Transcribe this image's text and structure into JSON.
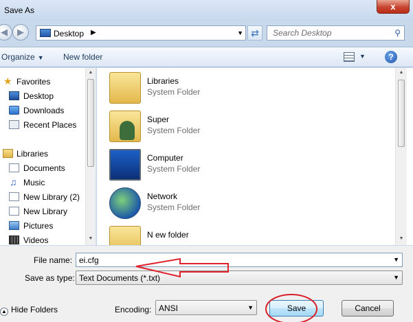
{
  "window": {
    "title": "Save As",
    "close_glyph": "x"
  },
  "nav": {
    "back_glyph": "◀",
    "forward_glyph": "▶",
    "address": {
      "label": "Desktop",
      "chevron": "▶",
      "dropdown": "▼"
    },
    "refresh_glyph": "⇄",
    "search": {
      "placeholder": "Search Desktop",
      "icon": "search-icon"
    }
  },
  "toolbar": {
    "organize_label": "Organize",
    "dropdown_arrow": "▼",
    "new_folder_label": "New folder",
    "help_glyph": "?"
  },
  "sidebar": {
    "items": [
      {
        "label": "Favorites",
        "icon": "star-icon"
      },
      {
        "label": "Desktop",
        "icon": "desktop-icon"
      },
      {
        "label": "Downloads",
        "icon": "downloads-icon"
      },
      {
        "label": "Recent Places",
        "icon": "recent-places-icon"
      },
      {
        "label": "Libraries",
        "icon": "libraries-icon"
      },
      {
        "label": "Documents",
        "icon": "documents-icon"
      },
      {
        "label": "Music",
        "icon": "music-icon"
      },
      {
        "label": "New Library (2)",
        "icon": "library-icon"
      },
      {
        "label": "New Library",
        "icon": "library-icon"
      },
      {
        "label": "Pictures",
        "icon": "pictures-icon"
      },
      {
        "label": "Videos",
        "icon": "videos-icon"
      }
    ]
  },
  "files": [
    {
      "name": "Libraries",
      "type": "System Folder",
      "icon": "libraries-folder-icon"
    },
    {
      "name": "Super",
      "type": "System Folder",
      "icon": "user-folder-icon"
    },
    {
      "name": "Computer",
      "type": "System Folder",
      "icon": "computer-icon"
    },
    {
      "name": "Network",
      "type": "System Folder",
      "icon": "network-icon"
    },
    {
      "name": "N ew folder",
      "type": "",
      "icon": "folder-icon"
    }
  ],
  "form": {
    "file_name_label": "File name:",
    "file_name_value": "ei.cfg",
    "save_type_label": "Save as type:",
    "save_type_value": "Text Documents (*.txt)",
    "encoding_label": "Encoding:",
    "encoding_value": "ANSI",
    "dropdown_arrow": "▼"
  },
  "footer": {
    "hide_folders_label": "Hide Folders",
    "hide_folders_glyph": "▲",
    "save_label": "Save",
    "cancel_label": "Cancel"
  },
  "annotation_colors": {
    "arrow": "#e0202a",
    "circle": "#d8202a"
  }
}
